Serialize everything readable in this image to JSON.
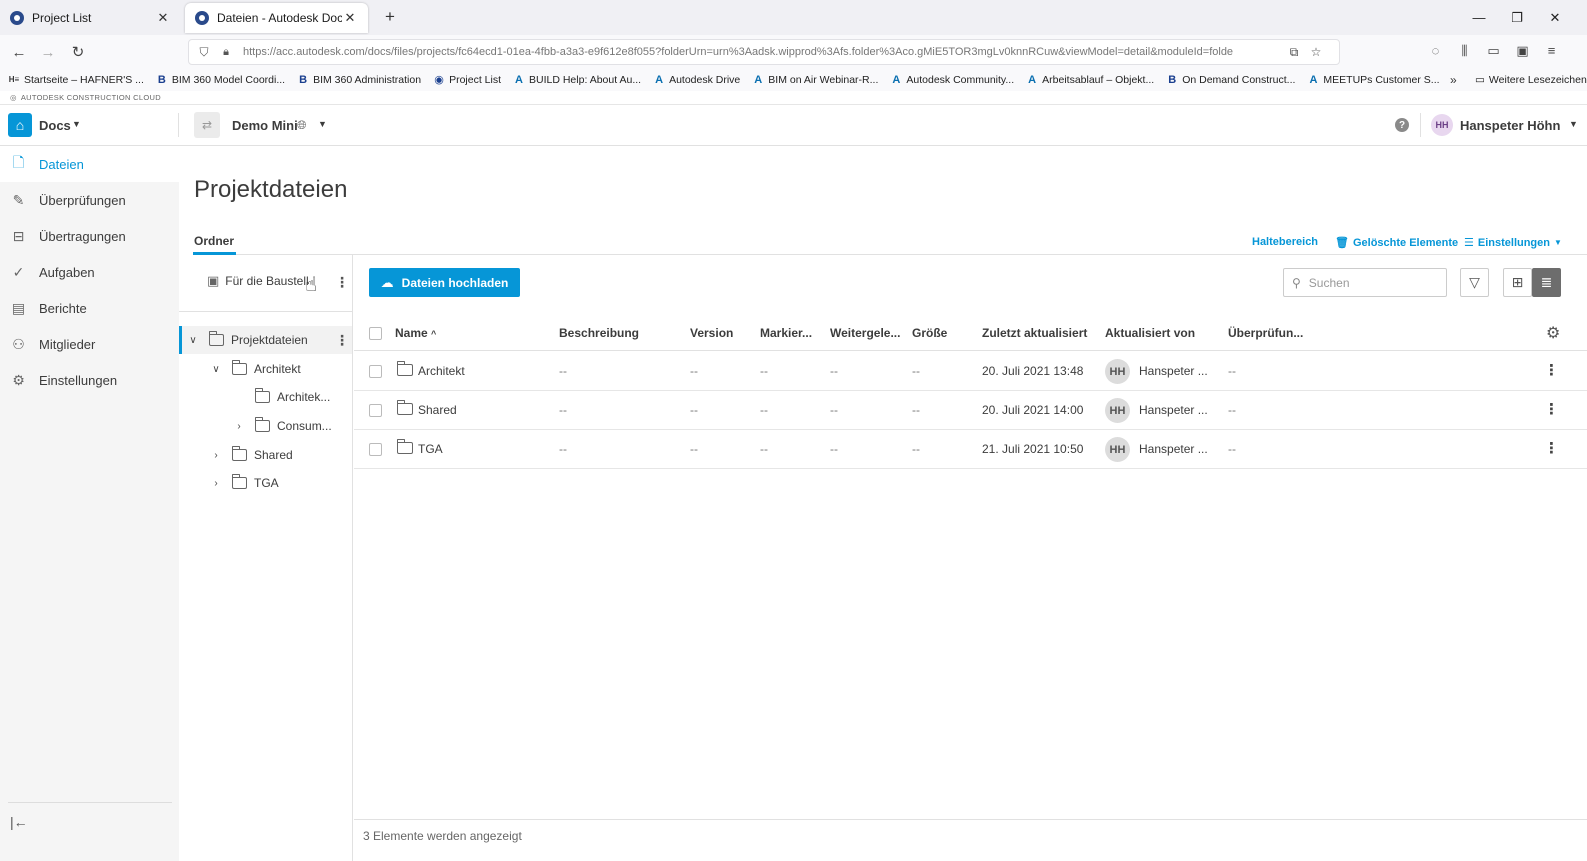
{
  "browser": {
    "tabs": [
      {
        "label": "Project List"
      },
      {
        "label": "Dateien - Autodesk Docs"
      }
    ],
    "url": "https://acc.autodesk.com/docs/files/projects/fc64ecd1-01ea-4fbb-a3a3-e9f612e8f055?folderUrn=urn%3Aadsk.wipprod%3Afs.folder%3Aco.gMiE5TOR3mgLv0knnRCuw&viewModel=detail&moduleId=folde",
    "bookmarks": [
      "Startseite – HAFNER'S ...",
      "BIM 360 Model Coordi...",
      "BIM 360 Administration",
      "Project List",
      "BUILD Help: About Au...",
      "Autodesk Drive",
      "BIM on Air Webinar-R...",
      "Autodesk Community...",
      "Arbeitsablauf – Objekt...",
      "On Demand Construct...",
      "MEETUPs Customer S..."
    ],
    "other_bookmarks": "Weitere Lesezeichen"
  },
  "brand": "AUTODESK CONSTRUCTION CLOUD",
  "header": {
    "app_name": "Docs",
    "project_name": "Demo Mini",
    "user_initials": "HH",
    "user_name": "Hanspeter Höhn"
  },
  "sidebar": {
    "items": [
      {
        "label": "Dateien",
        "icon": "file-icon",
        "active": true
      },
      {
        "label": "Überprüfungen",
        "icon": "review-icon"
      },
      {
        "label": "Übertragungen",
        "icon": "transmittal-icon"
      },
      {
        "label": "Aufgaben",
        "icon": "check-circle-icon"
      },
      {
        "label": "Berichte",
        "icon": "report-icon"
      },
      {
        "label": "Mitglieder",
        "icon": "members-icon"
      },
      {
        "label": "Einstellungen",
        "icon": "gear-icon"
      }
    ]
  },
  "main": {
    "title": "Projektdateien",
    "tab": "Ordner",
    "links": {
      "holding": "Haltebereich",
      "deleted": "Gelöschte Elemente",
      "settings": "Einstellungen"
    },
    "upload_label": "Dateien hochladen",
    "search_placeholder": "Suchen"
  },
  "tree": {
    "for_site": "Für die Baustelle",
    "nodes": [
      {
        "label": "Projektdateien"
      },
      {
        "label": "Architekt"
      },
      {
        "label": "Architek..."
      },
      {
        "label": "Consum..."
      },
      {
        "label": "Shared"
      },
      {
        "label": "TGA"
      }
    ]
  },
  "table": {
    "columns": [
      "Name",
      "Beschreibung",
      "Version",
      "Markier...",
      "Weitergele...",
      "Größe",
      "Zuletzt aktualisiert",
      "Aktualisiert von",
      "Überprüfun..."
    ],
    "rows": [
      {
        "name": "Architekt",
        "desc": "--",
        "version": "--",
        "markup": "--",
        "shared": "--",
        "size": "--",
        "updated": "20. Juli 2021 13:48",
        "by_initials": "HH",
        "by": "Hanspeter ...",
        "review": "--"
      },
      {
        "name": "Shared",
        "desc": "--",
        "version": "--",
        "markup": "--",
        "shared": "--",
        "size": "--",
        "updated": "20. Juli 2021 14:00",
        "by_initials": "HH",
        "by": "Hanspeter ...",
        "review": "--"
      },
      {
        "name": "TGA",
        "desc": "--",
        "version": "--",
        "markup": "--",
        "shared": "--",
        "size": "--",
        "updated": "21. Juli 2021 10:50",
        "by_initials": "HH",
        "by": "Hanspeter ...",
        "review": "--"
      }
    ],
    "footer": "3 Elemente werden angezeigt"
  },
  "colors": {
    "accent": "#0696d7",
    "sidebar_bg": "#f5f5f5"
  }
}
